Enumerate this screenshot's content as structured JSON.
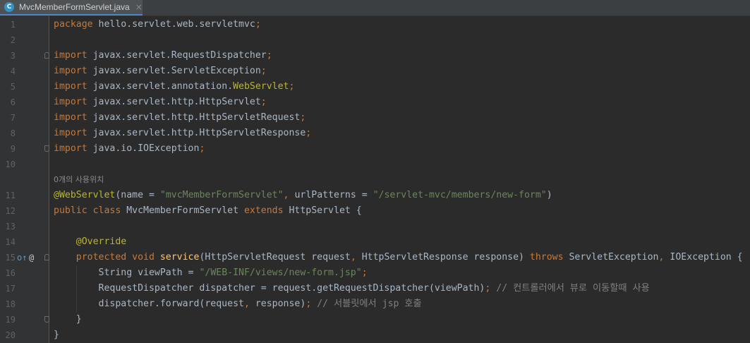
{
  "tab": {
    "filename": "MvcMemberFormServlet.java",
    "icon_letter": "C",
    "close": "×"
  },
  "gutter_icons": {
    "override_icon": "o↑",
    "annotation_icon": "@"
  },
  "usage_hint": "0개의 사용위치",
  "lines": [
    {
      "n": "1",
      "tokens": [
        {
          "t": "package",
          "c": "kw"
        },
        {
          "t": " hello.servlet.web.servletmvc"
        },
        {
          "t": ";",
          "c": "kw"
        }
      ]
    },
    {
      "n": "2",
      "tokens": []
    },
    {
      "n": "3",
      "fold": "top",
      "tokens": [
        {
          "t": "import",
          "c": "kw"
        },
        {
          "t": " javax.servlet.RequestDispatcher"
        },
        {
          "t": ";",
          "c": "kw"
        }
      ]
    },
    {
      "n": "4",
      "tokens": [
        {
          "t": "import",
          "c": "kw"
        },
        {
          "t": " javax.servlet.ServletException"
        },
        {
          "t": ";",
          "c": "kw"
        }
      ]
    },
    {
      "n": "5",
      "tokens": [
        {
          "t": "import",
          "c": "kw"
        },
        {
          "t": " javax.servlet.annotation."
        },
        {
          "t": "WebServlet",
          "c": "ann"
        },
        {
          "t": ";",
          "c": "kw"
        }
      ]
    },
    {
      "n": "6",
      "tokens": [
        {
          "t": "import",
          "c": "kw"
        },
        {
          "t": " javax.servlet.http.HttpServlet"
        },
        {
          "t": ";",
          "c": "kw"
        }
      ]
    },
    {
      "n": "7",
      "tokens": [
        {
          "t": "import",
          "c": "kw"
        },
        {
          "t": " javax.servlet.http.HttpServletRequest"
        },
        {
          "t": ";",
          "c": "kw"
        }
      ]
    },
    {
      "n": "8",
      "tokens": [
        {
          "t": "import",
          "c": "kw"
        },
        {
          "t": " javax.servlet.http.HttpServletResponse"
        },
        {
          "t": ";",
          "c": "kw"
        }
      ]
    },
    {
      "n": "9",
      "fold": "bottom",
      "tokens": [
        {
          "t": "import",
          "c": "kw"
        },
        {
          "t": " java.io.IOException"
        },
        {
          "t": ";",
          "c": "kw"
        }
      ]
    },
    {
      "n": "10",
      "tokens": []
    },
    {
      "n": "",
      "hint": true,
      "tokens": []
    },
    {
      "n": "11",
      "tokens": [
        {
          "t": "@WebServlet",
          "c": "ann"
        },
        {
          "t": "(name = "
        },
        {
          "t": "\"mvcMemberFormServlet\"",
          "c": "str"
        },
        {
          "t": ", ",
          "c": "kw"
        },
        {
          "t": "urlPatterns = "
        },
        {
          "t": "\"/servlet-mvc/members/new-form\"",
          "c": "str"
        },
        {
          "t": ")"
        }
      ]
    },
    {
      "n": "12",
      "tokens": [
        {
          "t": "public class ",
          "c": "kw"
        },
        {
          "t": "MvcMemberFormServlet "
        },
        {
          "t": "extends ",
          "c": "kw"
        },
        {
          "t": "HttpServlet {"
        }
      ]
    },
    {
      "n": "13",
      "tokens": []
    },
    {
      "n": "14",
      "tokens": [
        {
          "t": "    "
        },
        {
          "t": "@Override",
          "c": "ann"
        }
      ]
    },
    {
      "n": "15",
      "fold": "top",
      "gutter": true,
      "tokens": [
        {
          "t": "    "
        },
        {
          "t": "protected void ",
          "c": "kw"
        },
        {
          "t": "service",
          "c": "fn"
        },
        {
          "t": "(HttpServletRequest request"
        },
        {
          "t": ", ",
          "c": "kw"
        },
        {
          "t": "HttpServletResponse response) "
        },
        {
          "t": "throws ",
          "c": "kw"
        },
        {
          "t": "ServletException"
        },
        {
          "t": ", ",
          "c": "kw"
        },
        {
          "t": "IOException {"
        }
      ]
    },
    {
      "n": "16",
      "tokens": [
        {
          "t": "        String viewPath = "
        },
        {
          "t": "\"/WEB-INF/views/new-form.jsp\"",
          "c": "str"
        },
        {
          "t": ";",
          "c": "kw"
        }
      ]
    },
    {
      "n": "17",
      "tokens": [
        {
          "t": "        RequestDispatcher dispatcher = request.getRequestDispatcher(viewPath)"
        },
        {
          "t": "; ",
          "c": "kw"
        },
        {
          "t": "// 컨트롤러에서 뷰로 이동할때 사용",
          "c": "cmt"
        }
      ]
    },
    {
      "n": "18",
      "tokens": [
        {
          "t": "        dispatcher.forward(request"
        },
        {
          "t": ", ",
          "c": "kw"
        },
        {
          "t": "response)"
        },
        {
          "t": "; ",
          "c": "kw"
        },
        {
          "t": "// 서블릿에서 jsp 호출",
          "c": "cmt"
        }
      ]
    },
    {
      "n": "19",
      "fold": "bottom",
      "tokens": [
        {
          "t": "    }"
        }
      ]
    },
    {
      "n": "20",
      "tokens": [
        {
          "t": "}"
        }
      ]
    }
  ]
}
